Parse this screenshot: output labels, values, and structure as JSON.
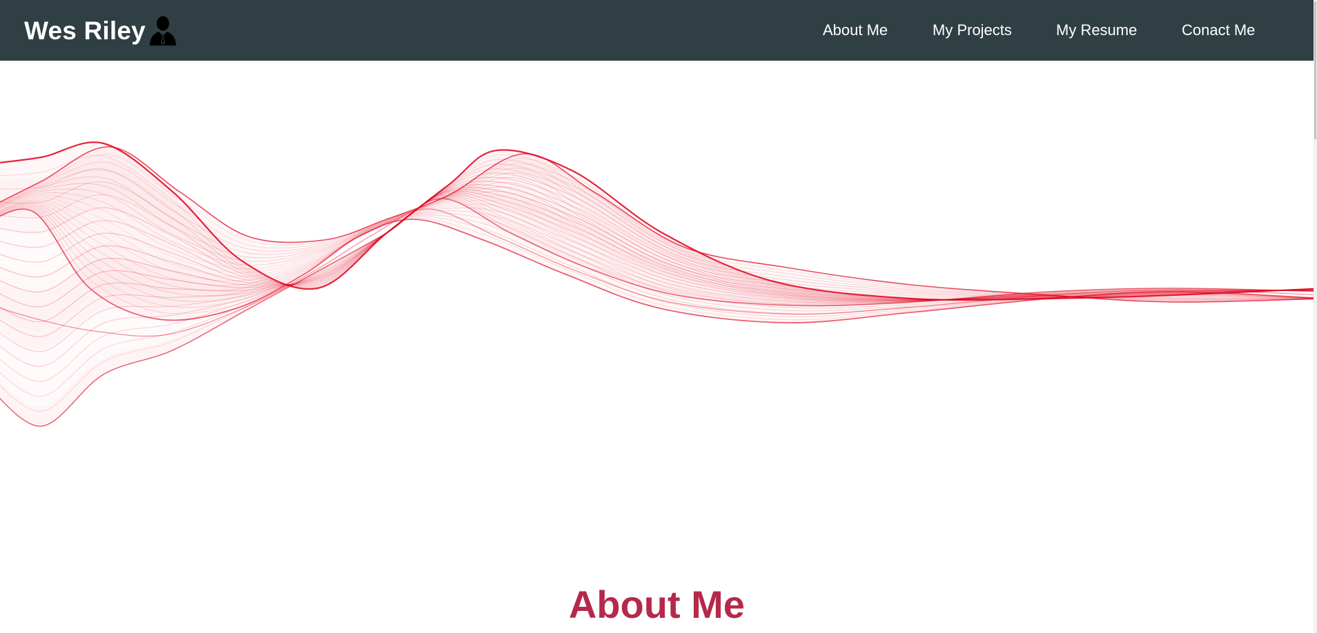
{
  "header": {
    "brand_name": "Wes Riley",
    "brand_icon": "person-silhouette-icon",
    "nav_items": [
      {
        "label": "About Me"
      },
      {
        "label": "My Projects"
      },
      {
        "label": "My Resume"
      },
      {
        "label": "Conact Me"
      }
    ],
    "background_color": "#2f3f44",
    "text_color": "#ffffff"
  },
  "hero": {
    "graphic": "red-silk-wave-image",
    "wave_color": "#e0001b"
  },
  "main": {
    "section_title": "About Me",
    "section_title_color": "#b5294a"
  }
}
